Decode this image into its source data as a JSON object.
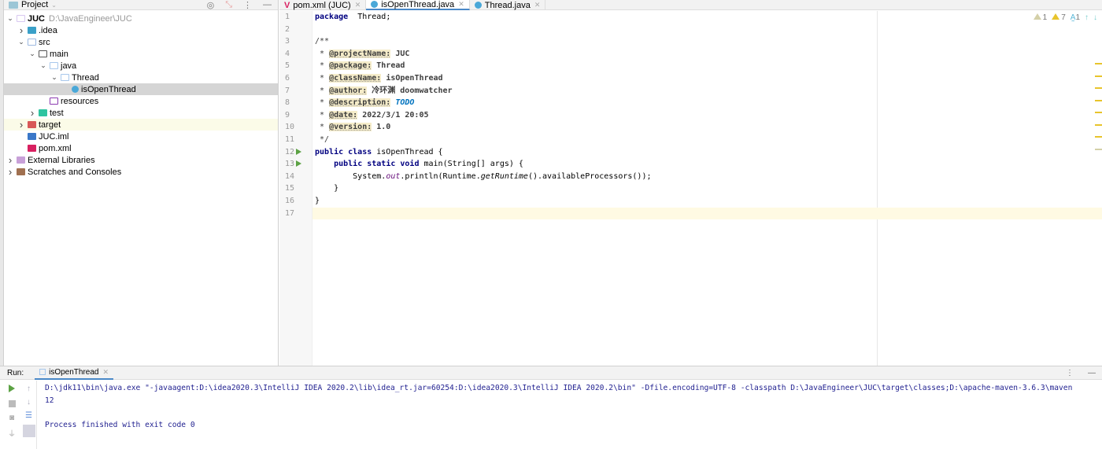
{
  "project": {
    "title": "Project",
    "tree": [
      {
        "label": "JUC",
        "path": "D:\\JavaEngineer\\JUC",
        "depth": 0,
        "arrow": "open",
        "icon": "module-folder-icon",
        "color": "#d8c8f0",
        "bold": true
      },
      {
        "label": ".idea",
        "depth": 1,
        "arrow": "closed",
        "icon": "idea-folder-icon",
        "color": "#3aa0c8"
      },
      {
        "label": "src",
        "depth": 1,
        "arrow": "open",
        "icon": "source-folder-icon",
        "color": "#9cb8e0"
      },
      {
        "label": "main",
        "depth": 2,
        "arrow": "open",
        "icon": "folder-icon",
        "color": "#555555"
      },
      {
        "label": "java",
        "depth": 3,
        "arrow": "open",
        "icon": "source-root-icon",
        "color": "#a8c8ec"
      },
      {
        "label": "Thread",
        "depth": 4,
        "arrow": "open",
        "icon": "package-icon",
        "color": "#a8c8ec"
      },
      {
        "label": "isOpenThread",
        "depth": 5,
        "arrow": "none",
        "icon": "java-class-icon",
        "color": "#4aa8d8",
        "selected": true
      },
      {
        "label": "resources",
        "depth": 3,
        "arrow": "none",
        "icon": "resources-folder-icon",
        "color": "#8a3ab0"
      },
      {
        "label": "test",
        "depth": 2,
        "arrow": "closed",
        "icon": "test-folder-icon",
        "color": "#2ec4a0"
      },
      {
        "label": "target",
        "depth": 1,
        "arrow": "closed",
        "icon": "excluded-folder-icon",
        "color": "#d85858",
        "highlight": true
      },
      {
        "label": "JUC.iml",
        "depth": 1,
        "arrow": "none",
        "icon": "iml-file-icon",
        "color": "#3a78c8"
      },
      {
        "label": "pom.xml",
        "depth": 1,
        "arrow": "none",
        "icon": "maven-icon",
        "color": "#d82060"
      },
      {
        "label": "External Libraries",
        "depth": 0,
        "arrow": "closed",
        "icon": "libraries-icon",
        "color": "#c8a0d8"
      },
      {
        "label": "Scratches and Consoles",
        "depth": 0,
        "arrow": "closed",
        "icon": "scratches-icon",
        "color": "#a07050"
      }
    ]
  },
  "tabs": [
    {
      "label": "pom.xml (JUC)",
      "icon": "maven-icon",
      "active": false
    },
    {
      "label": "isOpenThread.java",
      "icon": "java-class-icon",
      "active": true
    },
    {
      "label": "Thread.java",
      "icon": "java-class-icon",
      "active": false
    }
  ],
  "inspections": {
    "weak_warnings": "1",
    "warnings": "7",
    "typos": "1"
  },
  "code": [
    [
      [
        "kw",
        "package"
      ],
      [
        "",
        "  Thread;"
      ]
    ],
    [],
    [
      [
        "cm",
        "/**"
      ]
    ],
    [
      [
        "cm",
        " * "
      ],
      [
        "tag",
        "@projectName:"
      ],
      [
        "dv",
        " JUC"
      ]
    ],
    [
      [
        "cm",
        " * "
      ],
      [
        "tag",
        "@package:"
      ],
      [
        "dv",
        " Thread"
      ]
    ],
    [
      [
        "cm",
        " * "
      ],
      [
        "tag",
        "@className:"
      ],
      [
        "dv",
        " isOpenThread"
      ]
    ],
    [
      [
        "cm",
        " * "
      ],
      [
        "tag",
        "@author:"
      ],
      [
        "dv",
        " 冷环渊 doomwatcher"
      ]
    ],
    [
      [
        "cm",
        " * "
      ],
      [
        "tag",
        "@description:"
      ],
      [
        "todo",
        " TODO"
      ]
    ],
    [
      [
        "cm",
        " * "
      ],
      [
        "tag",
        "@date:"
      ],
      [
        "dv",
        " 2022/3/1 20:05"
      ]
    ],
    [
      [
        "cm",
        " * "
      ],
      [
        "tag",
        "@version:"
      ],
      [
        "dv",
        " 1.0"
      ]
    ],
    [
      [
        "cm",
        " */"
      ]
    ],
    [
      [
        "kw",
        "public class"
      ],
      [
        "",
        " isOpenThread {"
      ]
    ],
    [
      [
        "",
        "    "
      ],
      [
        "kw",
        "public static void"
      ],
      [
        "",
        " main(String[] args) {"
      ]
    ],
    [
      [
        "",
        "        System."
      ],
      [
        "fld",
        "out"
      ],
      [
        "",
        ".println(Runtime."
      ],
      [
        "it",
        "getRuntime"
      ],
      [
        "",
        "().availableProcessors());"
      ]
    ],
    [
      [
        "",
        "    }"
      ]
    ],
    [
      [
        "",
        "}"
      ]
    ],
    []
  ],
  "run_markers": [
    12,
    13
  ],
  "run": {
    "label": "Run:",
    "tab": "isOpenThread",
    "output": [
      "D:\\jdk11\\bin\\java.exe \"-javaagent:D:\\idea2020.3\\IntelliJ IDEA 2020.2\\lib\\idea_rt.jar=60254:D:\\idea2020.3\\IntelliJ IDEA 2020.2\\bin\" -Dfile.encoding=UTF-8 -classpath D:\\JavaEngineer\\JUC\\target\\classes;D:\\apache-maven-3.6.3\\maven",
      "12",
      "",
      "Process finished with exit code 0"
    ]
  }
}
